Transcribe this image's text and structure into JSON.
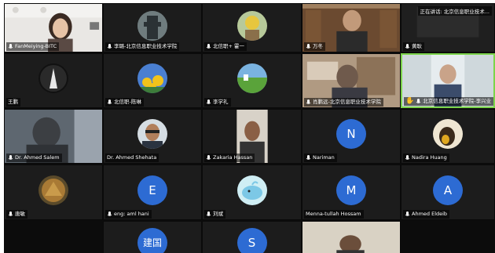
{
  "tiles": [
    {
      "name": "FanMeiying-BITC",
      "type": "video",
      "mic": true
    },
    {
      "name": "李璐-北京信息职业技术学院",
      "type": "avatar",
      "mic": true
    },
    {
      "name": "北信职+ 霍一",
      "type": "avatar",
      "mic": true
    },
    {
      "name": "万冬",
      "type": "video",
      "mic": true
    },
    {
      "name": "黄耿",
      "type": "video",
      "mic": true,
      "badge": "正在讲话: 北京信息职业技术..."
    },
    {
      "name": "王鹏",
      "type": "avatar",
      "mic": false
    },
    {
      "name": "北信职-陈琳",
      "type": "avatar",
      "mic": true
    },
    {
      "name": "李学礼",
      "type": "avatar",
      "mic": true
    },
    {
      "name": "肖鹏远-北京信息职业技术学院",
      "type": "video",
      "mic": true
    },
    {
      "name": "北京信息职业技术学院-李兴业",
      "type": "video",
      "mic": true,
      "active": true
    },
    {
      "name": "Dr. Ahmed Salem",
      "type": "video",
      "mic": true
    },
    {
      "name": "Dr. Ahmed Shehata",
      "type": "avatar",
      "mic": false
    },
    {
      "name": "Zakaria Hassan",
      "type": "video",
      "mic": true
    },
    {
      "name": "Nariman",
      "type": "letter",
      "letter": "N",
      "mic": true
    },
    {
      "name": "Nadira Huang",
      "type": "avatar",
      "mic": true
    },
    {
      "name": "唐敏",
      "type": "avatar",
      "mic": true
    },
    {
      "name": "eng: aml hani",
      "type": "letter",
      "letter": "E",
      "mic": true
    },
    {
      "name": "刘斌",
      "type": "avatar",
      "mic": true
    },
    {
      "name": "Menna-tullah Hossam",
      "type": "letter",
      "letter": "M",
      "mic": false
    },
    {
      "name": "Ahmed Eldeib",
      "type": "letter",
      "letter": "A",
      "mic": true
    },
    {
      "name": "",
      "type": "empty",
      "mic": false
    },
    {
      "name": "",
      "type": "letter",
      "letter": "建国",
      "mic": false
    },
    {
      "name": "",
      "type": "letter",
      "letter": "S",
      "mic": false
    },
    {
      "name": "",
      "type": "video",
      "mic": false
    },
    {
      "name": "",
      "type": "empty",
      "mic": false
    }
  ],
  "colors": {
    "accent": "#2d6bd3",
    "active_border": "#7bd44a",
    "background": "#0c0c0c"
  },
  "misc": {
    "hand_glyph": "☰"
  }
}
